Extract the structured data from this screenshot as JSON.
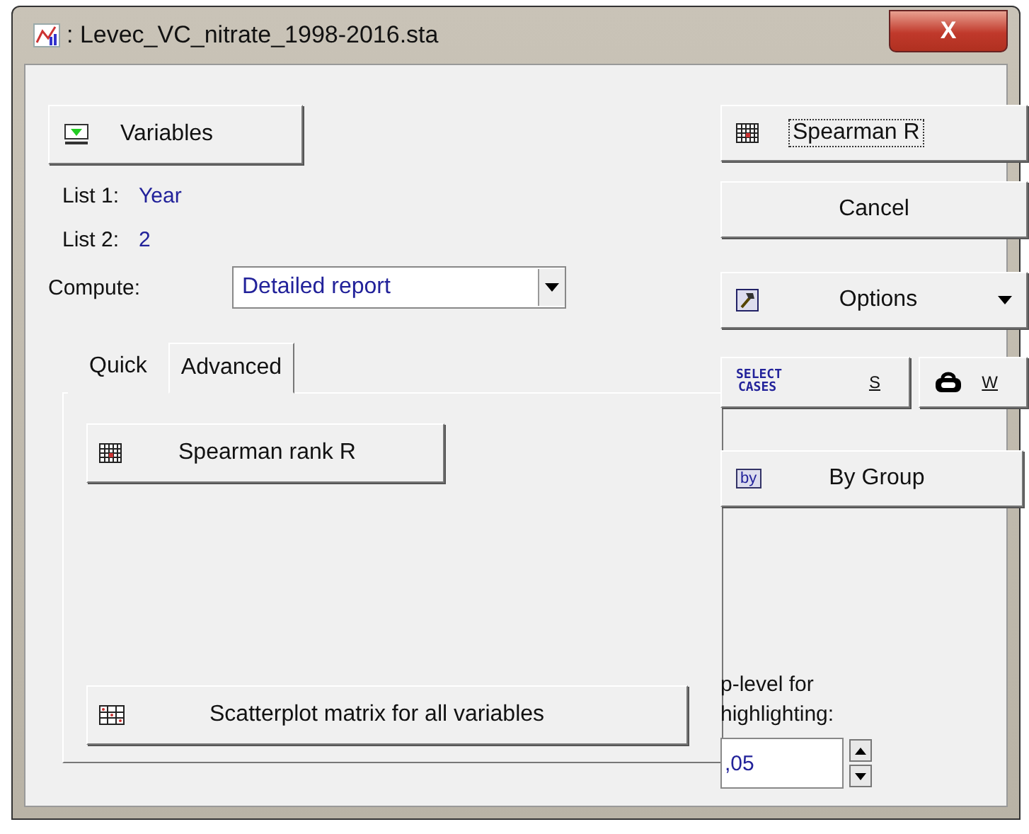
{
  "window": {
    "title": ": Levec_VC_nitrate_1998-2016.sta",
    "close": "X"
  },
  "variables_button": "Variables",
  "lists": [
    {
      "label": "List 1:",
      "value": "Year"
    },
    {
      "label": "List 2:",
      "value": "2"
    }
  ],
  "compute": {
    "label": "Compute:",
    "value": "Detailed report"
  },
  "tabs": [
    {
      "label": "Quick",
      "selected": true
    },
    {
      "label": "Advanced",
      "selected": false
    }
  ],
  "quick_buttons": [
    {
      "label": "Spearman rank R",
      "kind": "grid"
    },
    {
      "label": "Scatterplot matrix for all variables",
      "kind": "scatter"
    }
  ],
  "side": {
    "ok": "Spearman R",
    "cancel": "Cancel",
    "options": "Options",
    "select_cases": "SELECT CASES",
    "s": "S",
    "w": "W",
    "by_group": "By Group",
    "by_icon": "by"
  },
  "p_level": {
    "label": "p-level for highlighting:",
    "value": ",05"
  }
}
